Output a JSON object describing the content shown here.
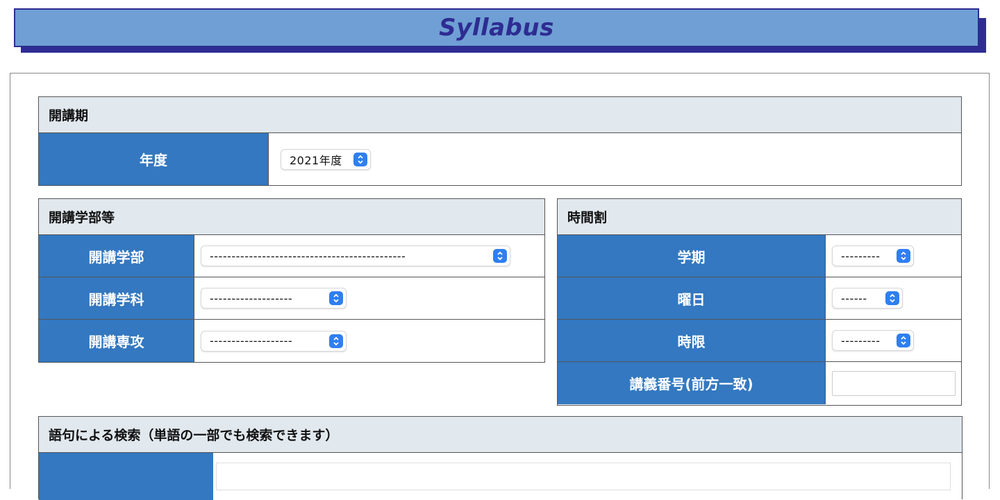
{
  "header": {
    "title": "Syllabus"
  },
  "period": {
    "heading": "開講期",
    "year_label": "年度",
    "year_value": "2021年度"
  },
  "faculty": {
    "heading": "開講学部等",
    "rows": [
      {
        "label": "開講学部",
        "value": "---------------------------------------------"
      },
      {
        "label": "開講学科",
        "value": "-------------------"
      },
      {
        "label": "開講専攻",
        "value": "-------------------"
      }
    ]
  },
  "timetable": {
    "heading": "時間割",
    "rows": [
      {
        "label": "学期",
        "value": "---------"
      },
      {
        "label": "曜日",
        "value": "------"
      },
      {
        "label": "時限",
        "value": "---------"
      },
      {
        "label": "講義番号(前方一致)",
        "value": ""
      }
    ]
  },
  "keyword": {
    "heading": "語句による検索（単語の一部でも検索できます）"
  },
  "colors": {
    "banner_bg": "#6f9fd4",
    "banner_fg": "#2e2c92",
    "label_bg": "#3378c0",
    "section_head_bg": "#e1e8ee",
    "select_accent": "#2f7ff0"
  }
}
